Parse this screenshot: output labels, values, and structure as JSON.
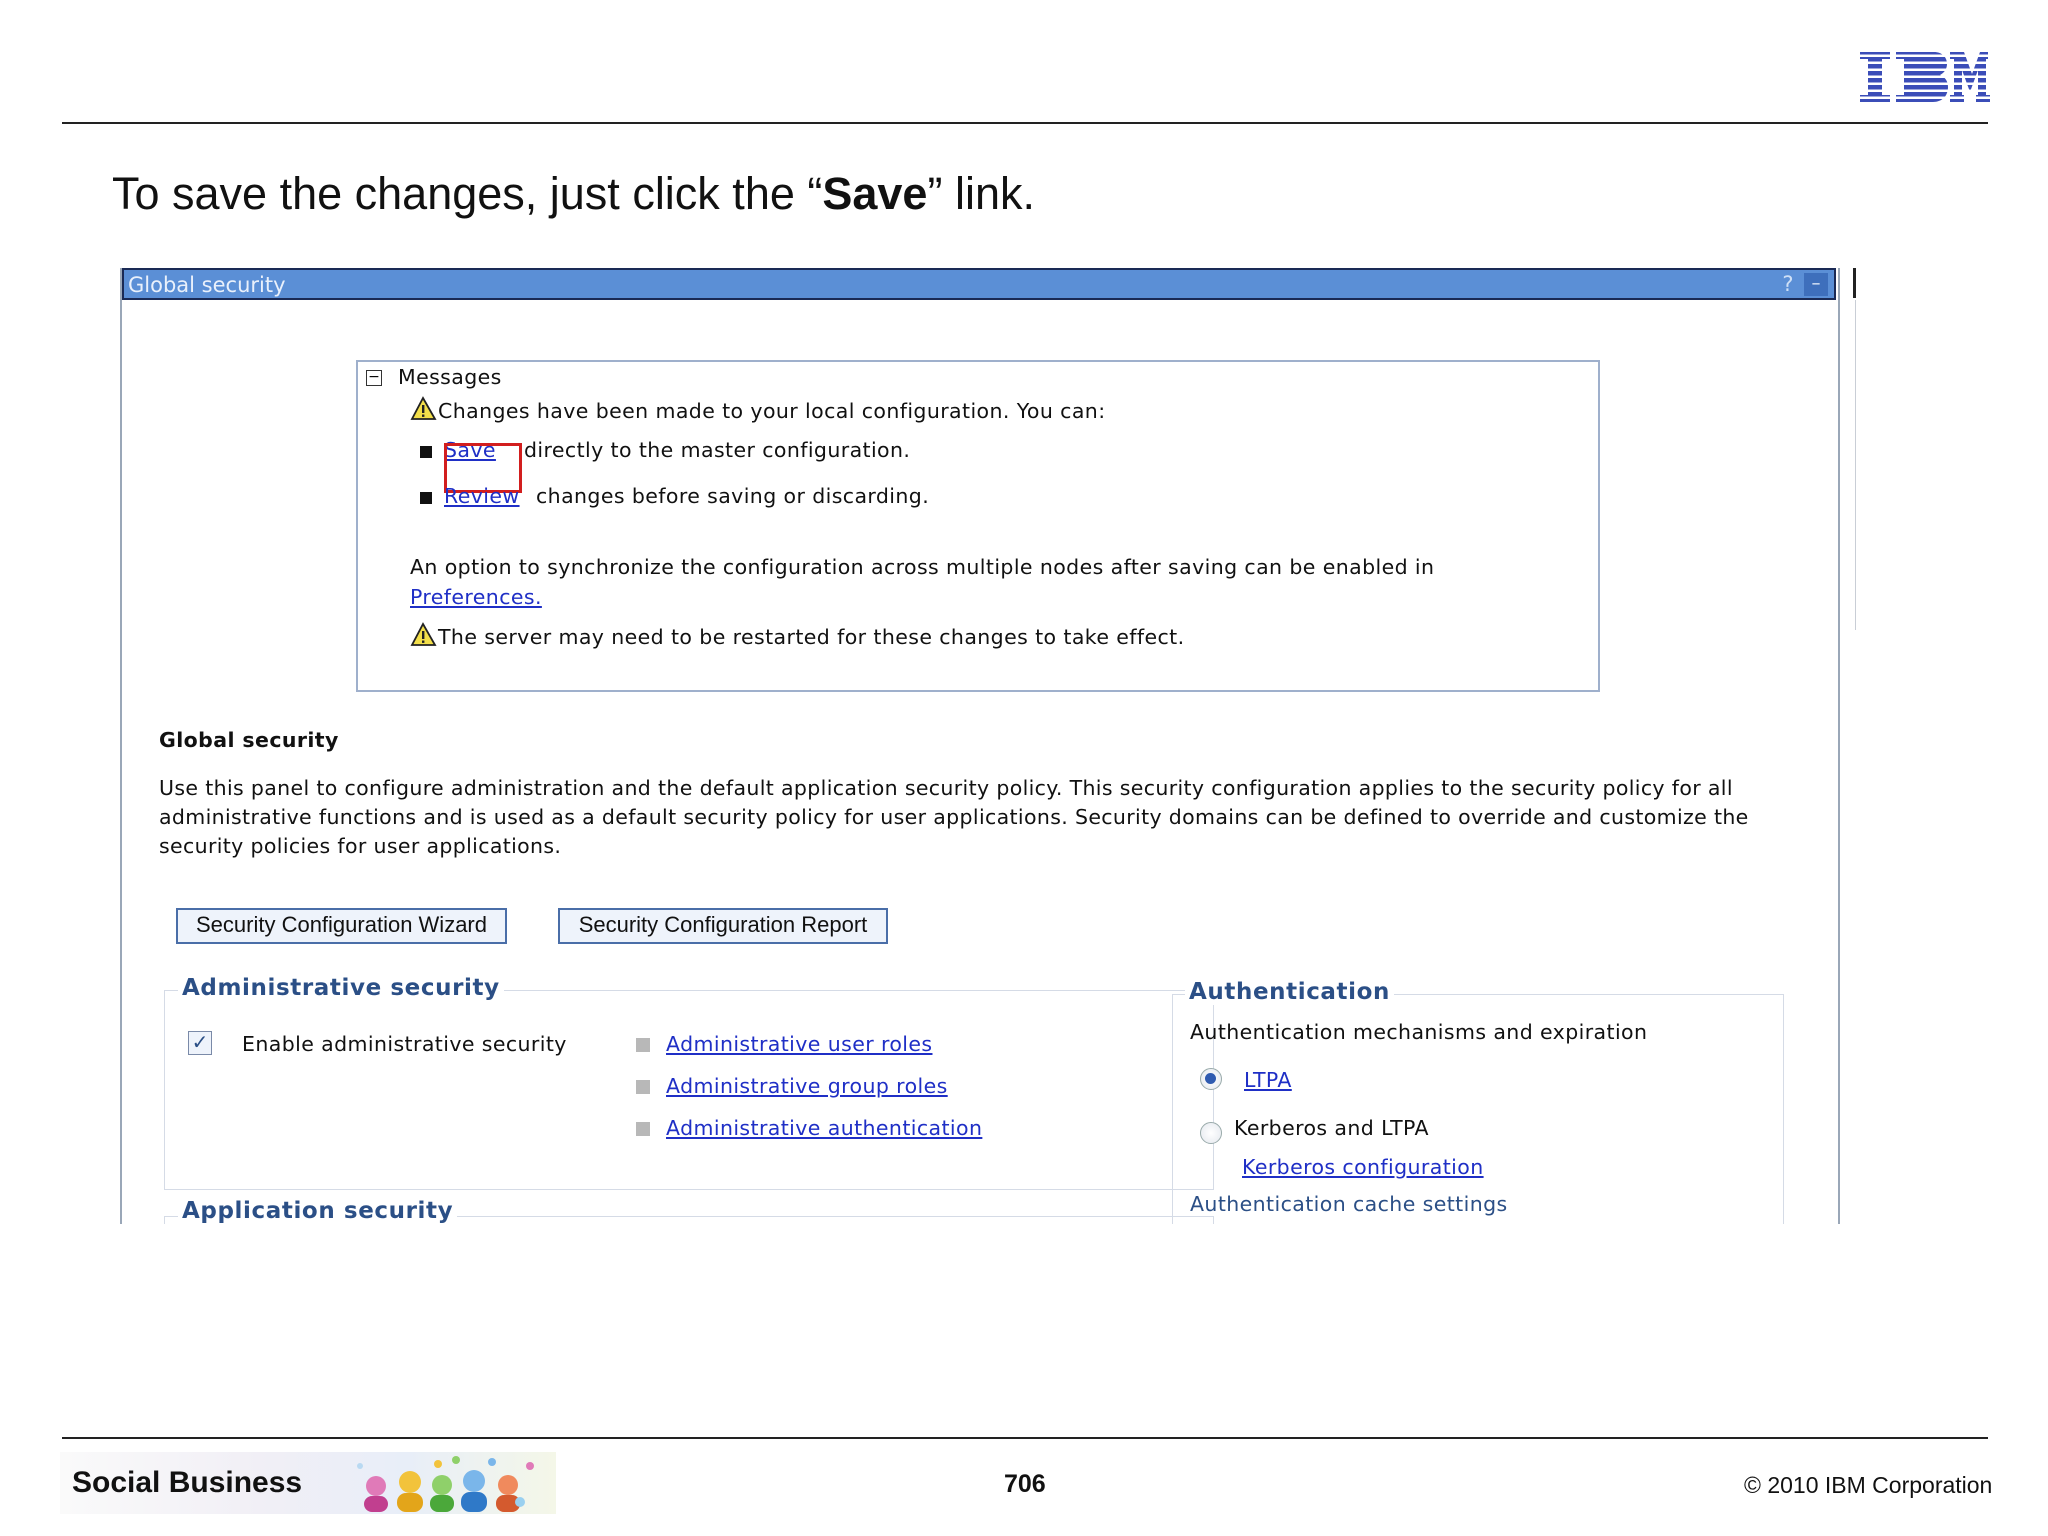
{
  "slide": {
    "logo_text": "IBM",
    "title_prefix": "To save the changes, just click the “",
    "title_bold": "Save",
    "title_suffix": "” link.",
    "footer_brand": "Social Business",
    "page_number": "706",
    "copyright": "© 2010 IBM Corporation"
  },
  "panel": {
    "title": "Global security",
    "help_glyph": "?",
    "minimize_glyph": "–"
  },
  "messages": {
    "heading": "Messages",
    "changes_notice": "Changes have been made to your local configuration. You can:",
    "save_link": "Save",
    "save_rest": "directly to the master configuration.",
    "review_link": "Review",
    "review_rest": "changes before saving or discarding.",
    "sync_text": "An option to synchronize the configuration across multiple nodes after saving can be enabled in",
    "preferences_link": "Preferences.",
    "restart_notice": "The server may need to be restarted for these changes to take effect."
  },
  "global_security": {
    "heading": "Global security",
    "description": "Use this panel to configure administration and the default application security policy. This security configuration applies to the security policy for all administrative functions and is used as a default security policy for user applications. Security domains can be defined to override and customize the security policies for user applications.",
    "wizard_button": "Security Configuration Wizard",
    "report_button": "Security Configuration Report"
  },
  "admin_security": {
    "title": "Administrative security",
    "checkbox_label": "Enable administrative security",
    "checkbox_checked": true,
    "links": [
      "Administrative user roles",
      "Administrative group roles",
      "Administrative authentication"
    ]
  },
  "authentication": {
    "title": "Authentication",
    "subtitle": "Authentication mechanisms and expiration",
    "ltpa_label": "LTPA",
    "ltpa_selected": true,
    "kerberos_label": "Kerberos and LTPA",
    "kerberos_config_link": "Kerberos configuration",
    "cache_link": "Authentication cache settings"
  },
  "app_security": {
    "title": "Application security"
  },
  "colors": {
    "titlebar": "#5b8fd6",
    "link": "#1f2fc6",
    "group_title": "#2b4f86",
    "highlight": "#d21e1e"
  }
}
